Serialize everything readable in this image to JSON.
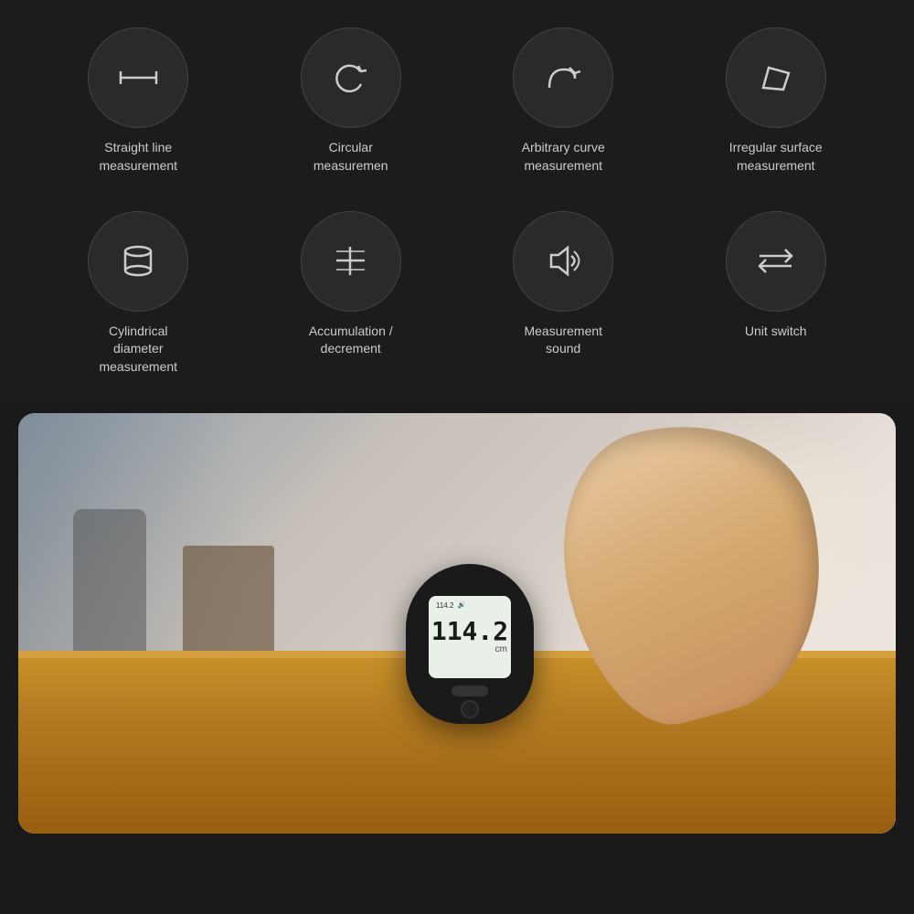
{
  "background": "#1c1c1c",
  "rows": [
    {
      "items": [
        {
          "id": "straight-line",
          "label": "Straight line\nmeasurement",
          "icon": "straight-line-icon"
        },
        {
          "id": "circular",
          "label": "Circular\nmeasuremen",
          "icon": "circular-icon"
        },
        {
          "id": "arbitrary-curve",
          "label": "Arbitrary curve\nmeasurement",
          "icon": "arbitrary-curve-icon"
        },
        {
          "id": "irregular-surface",
          "label": "Irregular surface\nmeasurement",
          "icon": "irregular-surface-icon"
        }
      ]
    },
    {
      "items": [
        {
          "id": "cylindrical",
          "label": "Cylindrical\ndiameter\nmeasurement",
          "icon": "cylindrical-icon"
        },
        {
          "id": "accumulation",
          "label": "Accumulation /\ndecrement",
          "icon": "accumulation-icon"
        },
        {
          "id": "measurement-sound",
          "label": "Measurement\nsound",
          "icon": "sound-icon"
        },
        {
          "id": "unit-switch",
          "label": "Unit switch",
          "icon": "unit-switch-icon"
        }
      ]
    }
  ],
  "device": {
    "display_top": "114.2",
    "display_main": "114.2",
    "unit": "cm"
  }
}
